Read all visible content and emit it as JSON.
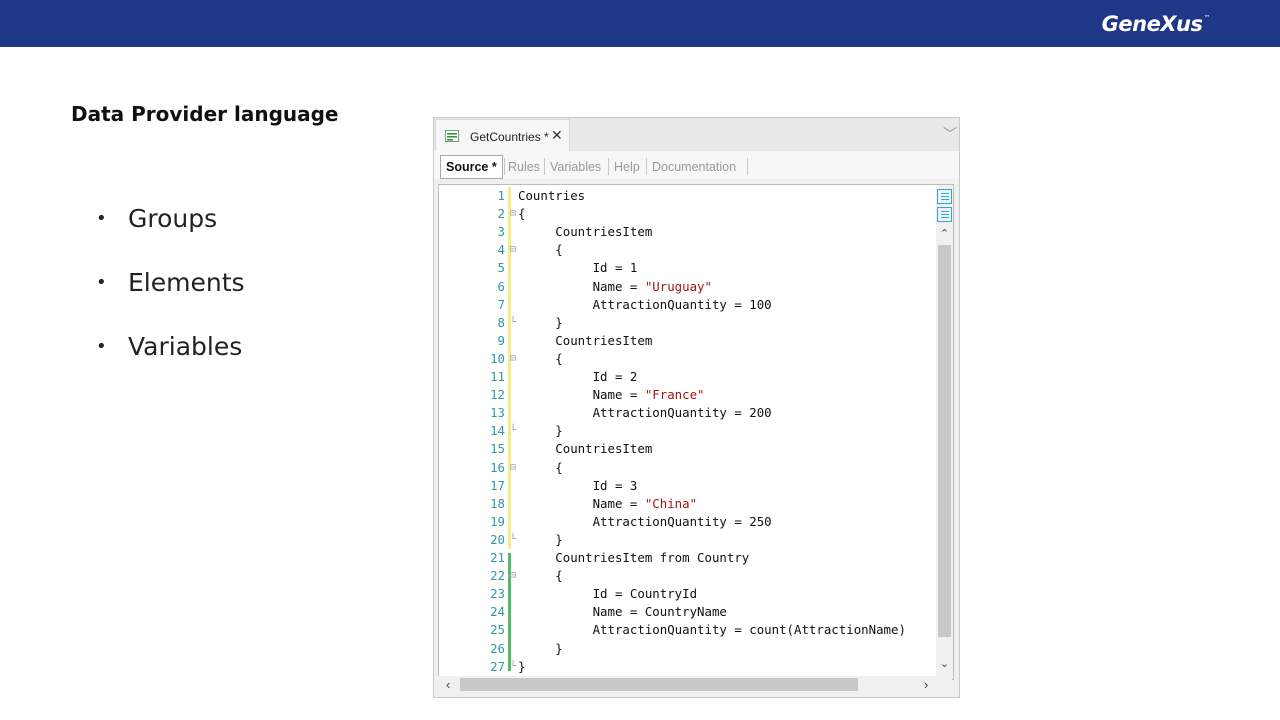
{
  "header": {
    "brand": "GeneXus",
    "trademark": "™"
  },
  "slide": {
    "title": "Data Provider language",
    "bullets": [
      "Groups",
      "Elements",
      "Variables"
    ]
  },
  "window": {
    "tab_label": "GetCountries *",
    "close_glyph": "✕",
    "overflow_glyph": "﹀",
    "subtabs": [
      "Source *",
      "Rules",
      "Variables",
      "Help",
      "Documentation"
    ]
  },
  "editor": {
    "lines": [
      {
        "n": "1",
        "t": "Countries"
      },
      {
        "n": "2",
        "t": "{"
      },
      {
        "n": "3",
        "t": "     CountriesItem"
      },
      {
        "n": "4",
        "t": "     {"
      },
      {
        "n": "5",
        "t": "          Id = 1"
      },
      {
        "n": "6",
        "t": "          Name = ",
        "s": "\"Uruguay\""
      },
      {
        "n": "7",
        "t": "          AttractionQuantity = 100"
      },
      {
        "n": "8",
        "t": "     }"
      },
      {
        "n": "9",
        "t": "     CountriesItem"
      },
      {
        "n": "10",
        "t": "     {"
      },
      {
        "n": "11",
        "t": "          Id = 2"
      },
      {
        "n": "12",
        "t": "          Name = ",
        "s": "\"France\""
      },
      {
        "n": "13",
        "t": "          AttractionQuantity = 200"
      },
      {
        "n": "14",
        "t": "     }"
      },
      {
        "n": "15",
        "t": "     CountriesItem"
      },
      {
        "n": "16",
        "t": "     {"
      },
      {
        "n": "17",
        "t": "          Id = 3"
      },
      {
        "n": "18",
        "t": "          Name = ",
        "s": "\"China\""
      },
      {
        "n": "19",
        "t": "          AttractionQuantity = 250"
      },
      {
        "n": "20",
        "t": "     }"
      },
      {
        "n": "21",
        "t": "     CountriesItem from Country"
      },
      {
        "n": "22",
        "t": "     {"
      },
      {
        "n": "23",
        "t": "          Id = CountryId"
      },
      {
        "n": "24",
        "t": "          Name = CountryName"
      },
      {
        "n": "25",
        "t": "          AttractionQuantity = count(AttractionName)"
      },
      {
        "n": "26",
        "t": "     }"
      },
      {
        "n": "27",
        "t": "}"
      }
    ],
    "fold_open_lines": [
      "2",
      "4",
      "10",
      "16",
      "22"
    ],
    "fold_end_lines": [
      "8",
      "14",
      "20",
      "27"
    ]
  },
  "scroll": {
    "up": "⌃",
    "down": "⌄",
    "left": "‹",
    "right": "›"
  },
  "colors": {
    "header_bg": "#1e3786",
    "string": "#a31515",
    "line_number": "#2f9aa3",
    "changed_bar": "#f5ec8b",
    "saved_bar": "#58b868"
  }
}
